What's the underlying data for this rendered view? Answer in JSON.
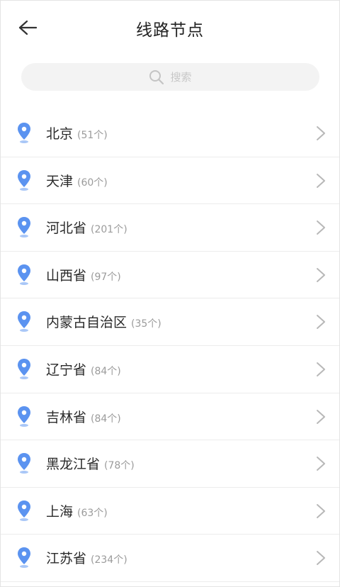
{
  "header": {
    "title": "线路节点",
    "back_icon": "arrow-left-icon"
  },
  "search": {
    "placeholder": "搜索",
    "icon": "search-icon"
  },
  "colors": {
    "pin": "#5b93f0",
    "pin_shadow": "#a9c7f7",
    "chevron": "#b8b8b8",
    "divider": "#ececec"
  },
  "regions": [
    {
      "name": "北京",
      "count": "(51个)"
    },
    {
      "name": "天津",
      "count": "(60个)"
    },
    {
      "name": "河北省",
      "count": "(201个)"
    },
    {
      "name": "山西省",
      "count": "(97个)"
    },
    {
      "name": "内蒙古自治区",
      "count": "(35个)"
    },
    {
      "name": "辽宁省",
      "count": "(84个)"
    },
    {
      "name": "吉林省",
      "count": "(84个)"
    },
    {
      "name": "黑龙江省",
      "count": "(78个)"
    },
    {
      "name": "上海",
      "count": "(63个)"
    },
    {
      "name": "江苏省",
      "count": "(234个)"
    }
  ]
}
